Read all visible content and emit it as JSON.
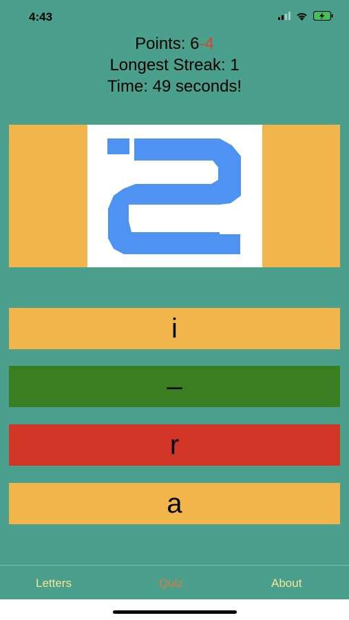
{
  "status": {
    "time": "4:43"
  },
  "stats": {
    "points_label": "Points: ",
    "points_correct": "6",
    "points_wrong": "-4",
    "streak": "Longest Streak: 1",
    "time": "Time: 49 seconds!"
  },
  "question": {
    "glyph_icon": "pixel-letter-icon"
  },
  "answers": [
    {
      "label": "i",
      "state": "neutral"
    },
    {
      "label": "–",
      "state": "correct"
    },
    {
      "label": "r",
      "state": "wrong"
    },
    {
      "label": "a",
      "state": "neutral"
    }
  ],
  "tabs": [
    {
      "label": "Letters",
      "active": false
    },
    {
      "label": "Quiz",
      "active": true
    },
    {
      "label": "About",
      "active": false
    }
  ],
  "colors": {
    "background": "#4aa08c",
    "neutral": "#f1b54b",
    "correct": "#3a7e22",
    "wrong": "#d03526",
    "glyph": "#4e92f2",
    "tab_inactive": "#f4e59a",
    "tab_active": "#e07a3a",
    "points_wrong": "#e0402c"
  }
}
